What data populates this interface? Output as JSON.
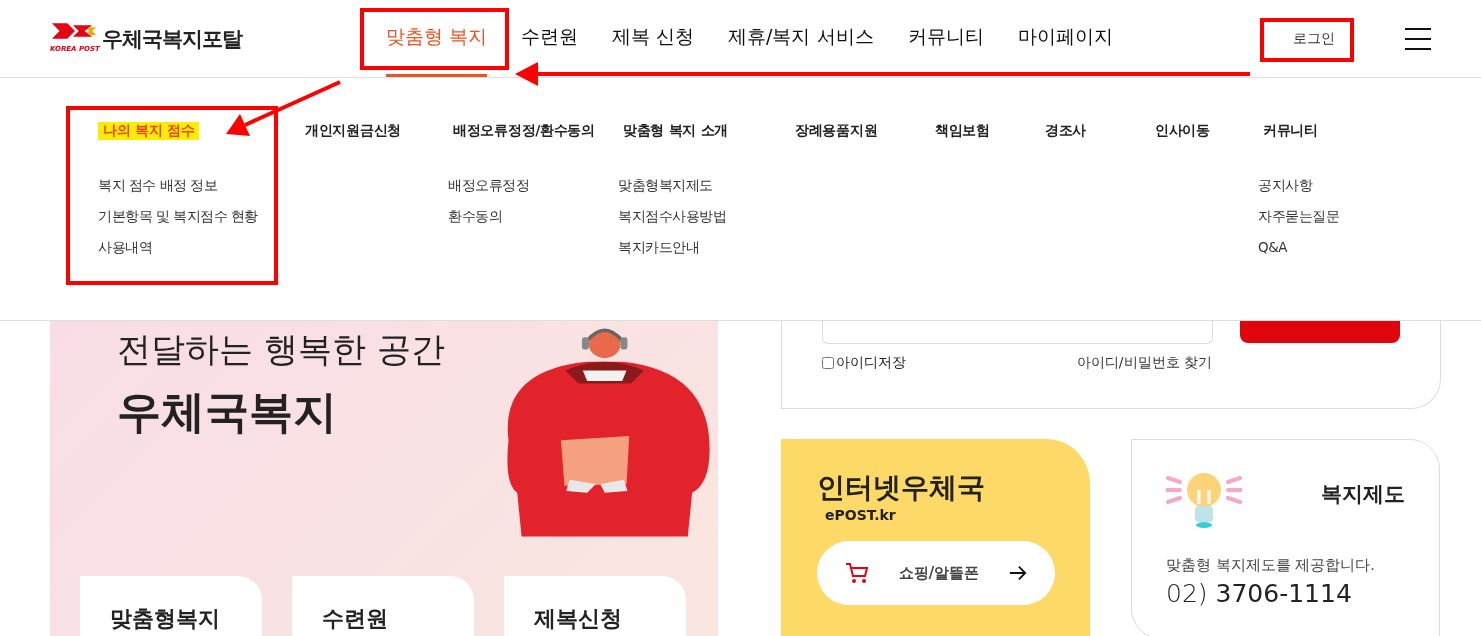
{
  "header": {
    "logo_text": "우체국복지포탈",
    "logo_sub": "KOREA POST",
    "nav": [
      {
        "label": "맞춤형 복지",
        "selected": true
      },
      {
        "label": "수련원",
        "selected": false
      },
      {
        "label": "제복 신청",
        "selected": false
      },
      {
        "label": "제휴/복지 서비스",
        "selected": false
      },
      {
        "label": "커뮤니티",
        "selected": false
      },
      {
        "label": "마이페이지",
        "selected": false
      }
    ],
    "login": "로그인"
  },
  "mega_menu": [
    {
      "title": "나의 복지 점수",
      "highlighted": true,
      "items": [
        "복지 점수 배정 정보",
        "기본항목 및 복지점수 현황",
        "사용내역"
      ]
    },
    {
      "title": "개인지원금신청",
      "highlighted": false
    },
    {
      "title": "배정오류정정/환수동의",
      "highlighted": false,
      "items": [
        "배정오류정정",
        "환수동의"
      ]
    },
    {
      "title": "맞춤형 복지 소개",
      "highlighted": false,
      "items": [
        "맞춤형복지제도",
        "복지점수사용방법",
        "복지카드안내"
      ]
    },
    {
      "title": "장례용품지원",
      "highlighted": false
    },
    {
      "title": "책임보험",
      "highlighted": false
    },
    {
      "title": "경조사",
      "highlighted": false
    },
    {
      "title": "인사이동",
      "highlighted": false
    },
    {
      "title": "커뮤니티",
      "highlighted": false,
      "items": [
        "공지사항",
        "자주묻는질문",
        "Q&A"
      ]
    }
  ],
  "hero": {
    "line": "전달하는 행복한 공간",
    "title": "우체국복지",
    "cards": [
      "맞춤형복지",
      "수련원",
      "제복신청"
    ]
  },
  "login_card": {
    "save_id": {
      "label": "아이디저장",
      "checked": false
    },
    "find_link": "아이디/비밀번호 찾기"
  },
  "epost_card": {
    "title": "인터넷우체국",
    "sub": "ePOST.kr",
    "button": "쇼핑/알뜰폰"
  },
  "welfare_card": {
    "title": "복지제도",
    "description": "맞춤형 복지제도를 제공합니다.",
    "phone": "02) **3706-1114**"
  }
}
